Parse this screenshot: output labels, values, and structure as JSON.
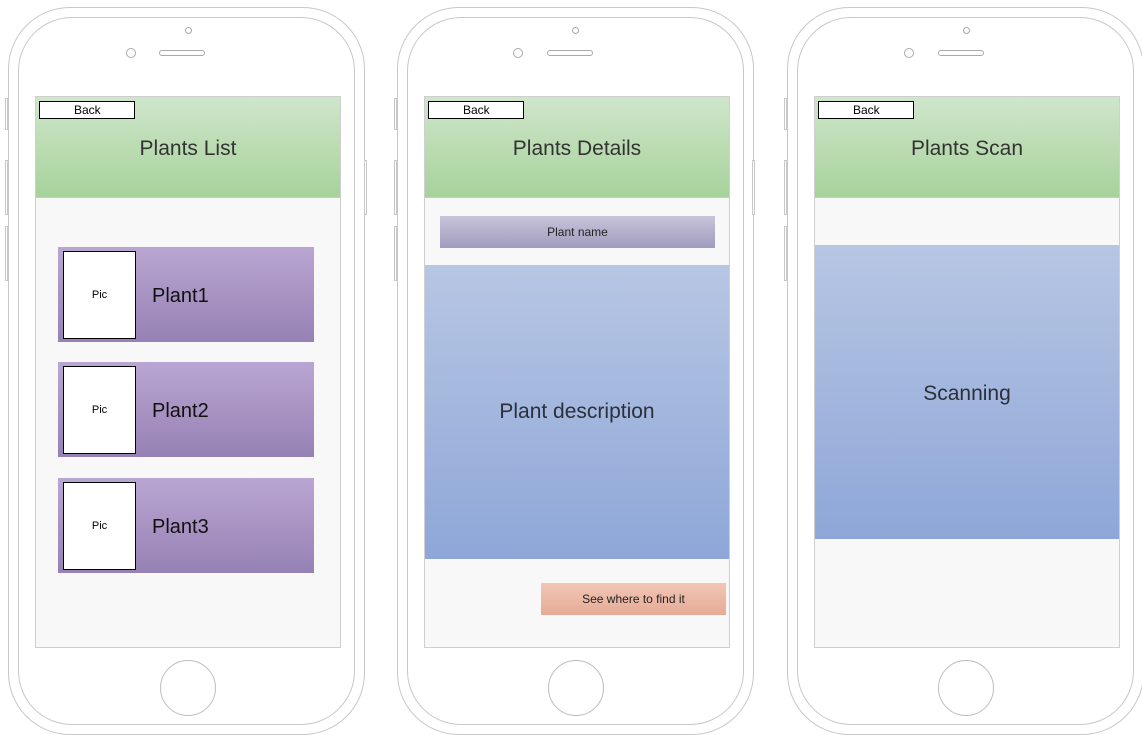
{
  "screens": [
    {
      "title": "Plants List",
      "back_label": "Back",
      "items": [
        {
          "pic_label": "Pic",
          "name": "Plant1"
        },
        {
          "pic_label": "Pic",
          "name": "Plant2"
        },
        {
          "pic_label": "Pic",
          "name": "Plant3"
        }
      ]
    },
    {
      "title": "Plants Details",
      "back_label": "Back",
      "plant_name": "Plant name",
      "description": "Plant description",
      "find_button": "See where to find it"
    },
    {
      "title": "Plants Scan",
      "back_label": "Back",
      "scan_status": "Scanning"
    }
  ],
  "colors": {
    "header": "#a7d29b",
    "list_item": "#9681b4",
    "content_box": "#8ea7d8",
    "find_button": "#e6ab96"
  }
}
